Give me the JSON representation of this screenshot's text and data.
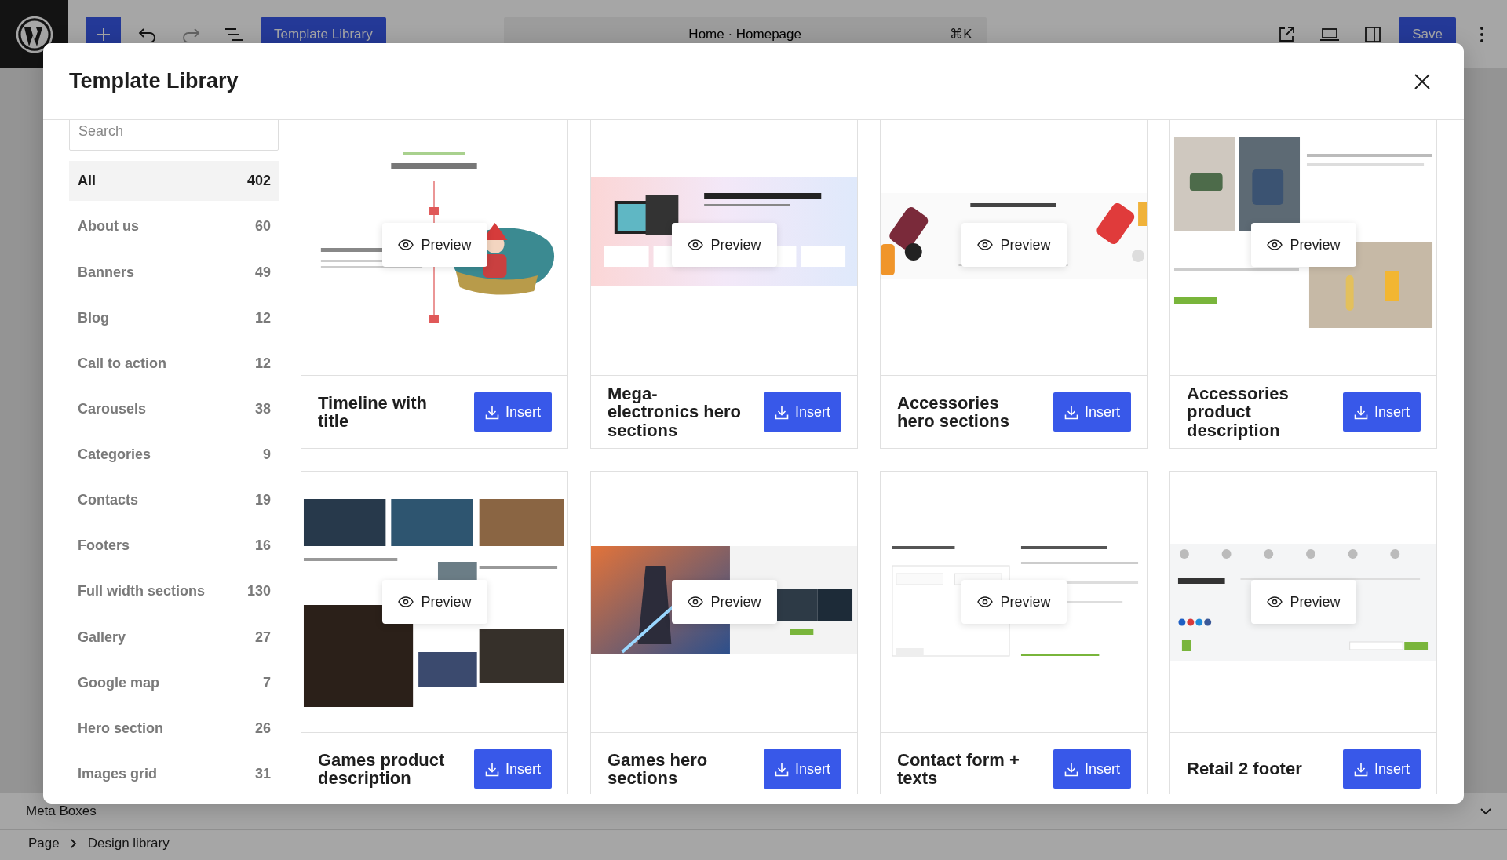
{
  "toolbar": {
    "template_button": "Template Library",
    "command_bar": {
      "title": "Home · Homepage",
      "shortcut": "⌘K"
    },
    "save_button": "Save"
  },
  "modal": {
    "title": "Template Library",
    "sidebar": {
      "search": {
        "placeholder": "Search"
      },
      "categories": [
        {
          "label": "All",
          "count": "402",
          "selected": true
        },
        {
          "label": "About us",
          "count": "60",
          "selected": false
        },
        {
          "label": "Banners",
          "count": "49",
          "selected": false
        },
        {
          "label": "Blog",
          "count": "12",
          "selected": false
        },
        {
          "label": "Call to action",
          "count": "12",
          "selected": false
        },
        {
          "label": "Carousels",
          "count": "38",
          "selected": false
        },
        {
          "label": "Categories",
          "count": "9",
          "selected": false
        },
        {
          "label": "Contacts",
          "count": "19",
          "selected": false
        },
        {
          "label": "Footers",
          "count": "16",
          "selected": false
        },
        {
          "label": "Full width sections",
          "count": "130",
          "selected": false
        },
        {
          "label": "Gallery",
          "count": "27",
          "selected": false
        },
        {
          "label": "Google map",
          "count": "7",
          "selected": false
        },
        {
          "label": "Hero section",
          "count": "26",
          "selected": false
        },
        {
          "label": "Images grid",
          "count": "31",
          "selected": false
        }
      ]
    },
    "templates": [
      {
        "title": "Timeline with title",
        "preview": "Preview",
        "insert": "Insert"
      },
      {
        "title": "Mega-electronics hero sections",
        "preview": "Preview",
        "insert": "Insert"
      },
      {
        "title": "Accessories hero sections",
        "preview": "Preview",
        "insert": "Insert"
      },
      {
        "title": "Accessories product description",
        "preview": "Preview",
        "insert": "Insert"
      },
      {
        "title": "Games product description",
        "preview": "Preview",
        "insert": "Insert"
      },
      {
        "title": "Games hero sections",
        "preview": "Preview",
        "insert": "Insert"
      },
      {
        "title": "Contact form + texts",
        "preview": "Preview",
        "insert": "Insert"
      },
      {
        "title": "Retail 2 footer",
        "preview": "Preview",
        "insert": "Insert"
      }
    ]
  },
  "meta_boxes": {
    "label": "Meta Boxes"
  },
  "breadcrumb": [
    "Page",
    "Design library"
  ]
}
